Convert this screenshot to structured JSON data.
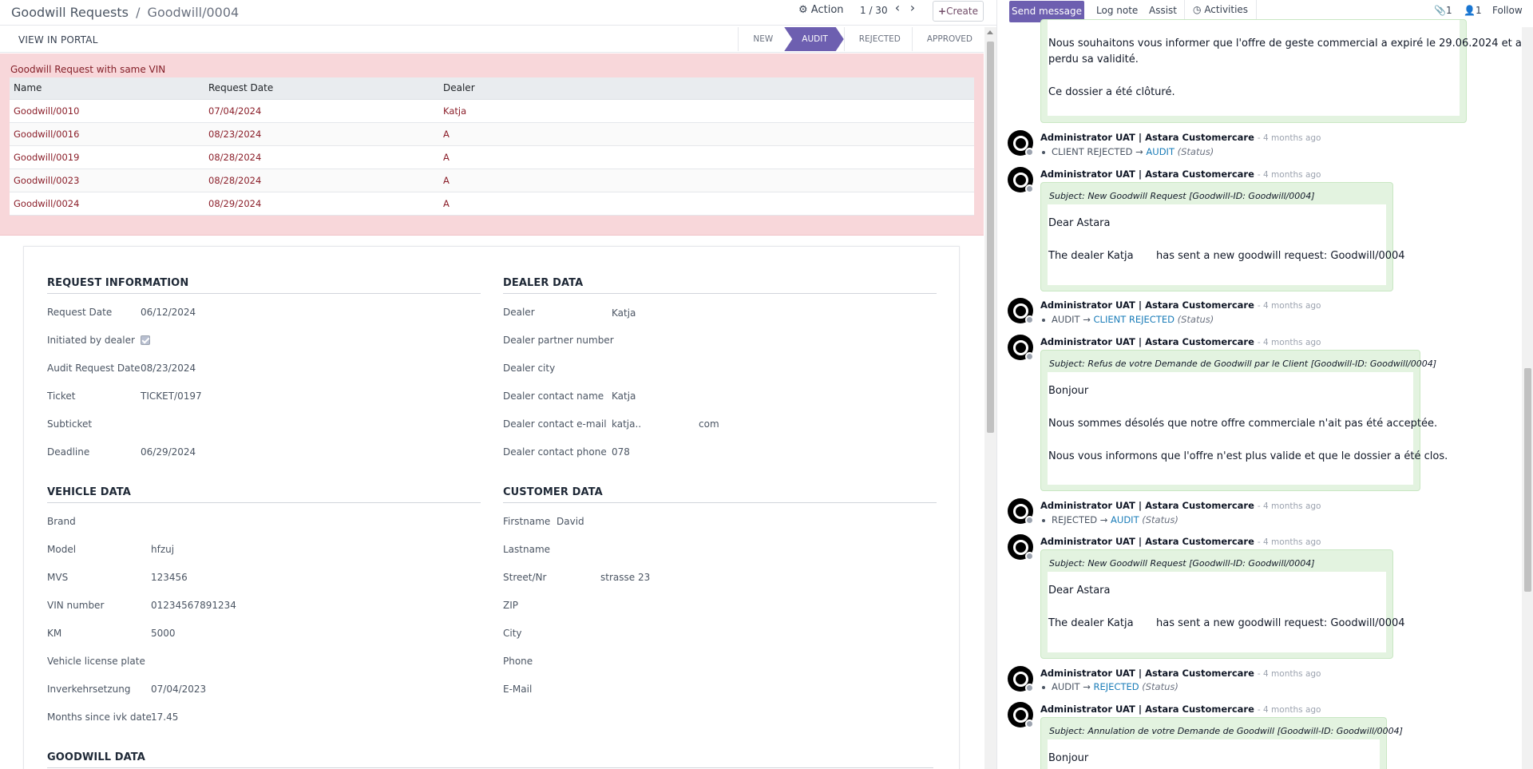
{
  "breadcrumb": {
    "parent": "Goodwill Requests",
    "separator": "/",
    "current": "Goodwill/0004"
  },
  "toolbar": {
    "action_label": "Action",
    "pager": "1 / 30",
    "create_label": "Create"
  },
  "status": {
    "portal_label": "VIEW IN PORTAL",
    "stages": [
      "NEW",
      "AUDIT",
      "REJECTED",
      "APPROVED"
    ],
    "active_stage": "AUDIT"
  },
  "alert": {
    "title": "Goodwill Request with same VIN",
    "columns": [
      "Name",
      "Request Date",
      "Dealer"
    ],
    "rows": [
      {
        "name": "Goodwill/0010",
        "date": "07/04/2024",
        "dealer": "Katja"
      },
      {
        "name": "Goodwill/0016",
        "date": "08/23/2024",
        "dealer": "A"
      },
      {
        "name": "Goodwill/0019",
        "date": "08/28/2024",
        "dealer": "A"
      },
      {
        "name": "Goodwill/0023",
        "date": "08/28/2024",
        "dealer": "A"
      },
      {
        "name": "Goodwill/0024",
        "date": "08/29/2024",
        "dealer": "A"
      }
    ]
  },
  "request_info": {
    "title": "REQUEST INFORMATION",
    "request_date_label": "Request Date",
    "request_date": "06/12/2024",
    "initiated_label": "Initiated by dealer",
    "audit_date_label": "Audit Request Date",
    "audit_date": "08/23/2024",
    "ticket_label": "Ticket",
    "ticket": "TICKET/0197",
    "subticket_label": "Subticket",
    "deadline_label": "Deadline",
    "deadline": "06/29/2024"
  },
  "dealer_data": {
    "title": "DEALER DATA",
    "dealer_label": "Dealer",
    "dealer": "Katja",
    "partner_label": "Dealer partner number",
    "city_label": "Dealer city",
    "contact_name_label": "Dealer contact name",
    "contact_name": "Katja",
    "contact_email_label": "Dealer contact e-mail",
    "contact_email_a": "katja..",
    "contact_email_b": "com",
    "contact_phone_label": "Dealer contact phone",
    "contact_phone": "078"
  },
  "vehicle_data": {
    "title": "VEHICLE DATA",
    "brand_label": "Brand",
    "model_label": "Model",
    "model": "hfzuj",
    "mvs_label": "MVS",
    "mvs": "123456",
    "vin_label": "VIN number",
    "vin": "01234567891234",
    "km_label": "KM",
    "km": "5000",
    "plate_label": "Vehicle license plate",
    "ivk_label": "Inverkehrsetzung",
    "ivk": "07/04/2023",
    "months_label": "Months since ivk date",
    "months": "17.45"
  },
  "customer_data": {
    "title": "CUSTOMER DATA",
    "firstname_label": "Firstname",
    "firstname": "David",
    "lastname_label": "Lastname",
    "street_label": "Street/Nr",
    "street": "strasse 23",
    "zip_label": "ZIP",
    "city_label": "City",
    "phone_label": "Phone",
    "email_label": "E-Mail"
  },
  "goodwill_data": {
    "title": "GOODWILL DATA"
  },
  "chatter": {
    "send_label": "Send message",
    "log_label": "Log note",
    "assist_label": "Assist",
    "activities_label": "Activities",
    "attach_count": "1",
    "follower_count": "1",
    "follow_label": "Follow",
    "author": "Administrator UAT | Astara Customercare",
    "ago": "- 4 months ago",
    "status_field": "(Status)",
    "msg0": {
      "line1": "Nous souhaitons vous informer que l'offre de geste commercial a expiré le 29.06.2024 et a",
      "line2": "perdu sa validité.",
      "line3": "Ce dossier a été clôturé."
    },
    "track1": {
      "old": "CLIENT REJECTED",
      "new": "AUDIT"
    },
    "msg2": {
      "subject": "Subject: New Goodwill Request [Goodwill-ID: Goodwill/0004]",
      "line1": "Dear Astara",
      "line2a": "The dealer Katja",
      "line2b": "has sent a new goodwill request: Goodwill/0004"
    },
    "track3": {
      "old": "AUDIT",
      "new": "CLIENT REJECTED"
    },
    "msg4": {
      "subject": "Subject: Refus de votre Demande de Goodwill par le Client [Goodwill-ID: Goodwill/0004]",
      "line1": "Bonjour",
      "line2": "Nous sommes désolés que notre offre commerciale n'ait pas été acceptée.",
      "line3": "Nous vous informons que l'offre n'est plus valide et que le dossier a été clos."
    },
    "track5": {
      "old": "REJECTED",
      "new": "AUDIT"
    },
    "msg6": {
      "subject": "Subject: New Goodwill Request [Goodwill-ID: Goodwill/0004]",
      "line1": "Dear Astara",
      "line2a": "The dealer Katja",
      "line2b": "has sent a new goodwill request: Goodwill/0004"
    },
    "track7": {
      "old": "AUDIT",
      "new": "REJECTED"
    },
    "msg8": {
      "subject": "Subject: Annulation de votre Demande de Goodwill [Goodwill-ID: Goodwill/0004]",
      "line1": "Bonjour"
    }
  },
  "colors": {
    "primary": "#6d5fb0",
    "alert_bg": "#f8d7da",
    "chat_bubble": "#e3f3e0",
    "link": "#1a7cb8"
  }
}
